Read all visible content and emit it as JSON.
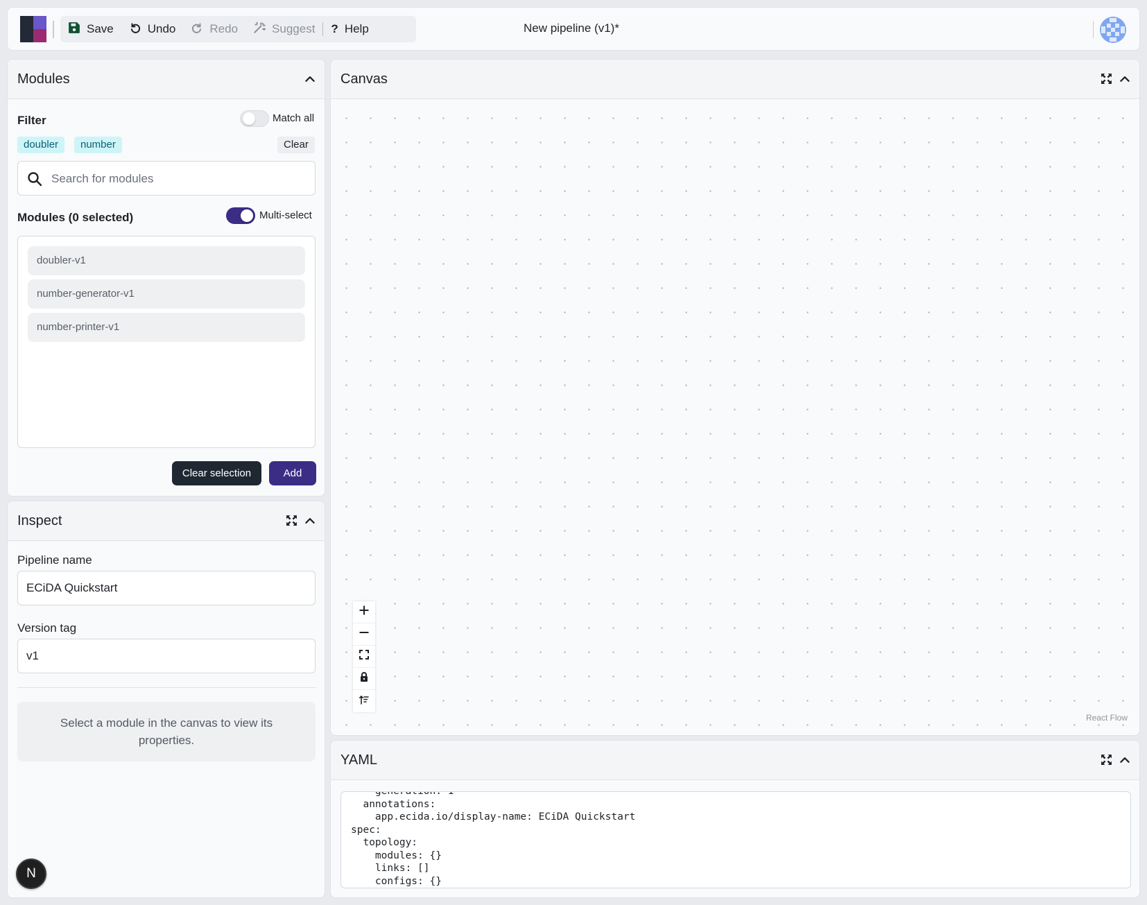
{
  "toolbar": {
    "save": "Save",
    "undo": "Undo",
    "redo": "Redo",
    "suggest": "Suggest",
    "help": "Help"
  },
  "pipeline_title": "New pipeline (v1)*",
  "modules_panel": {
    "title": "Modules",
    "filter_label": "Filter",
    "match_all_label": "Match all",
    "match_all_on": false,
    "chips": [
      "doubler",
      "number"
    ],
    "clear_label": "Clear",
    "search_placeholder": "Search for modules",
    "list_title": "Modules (0 selected)",
    "multi_select_label": "Multi-select",
    "multi_select_on": true,
    "items": [
      "doubler-v1",
      "number-generator-v1",
      "number-printer-v1"
    ],
    "clear_selection_label": "Clear selection",
    "add_label": "Add"
  },
  "inspect_panel": {
    "title": "Inspect",
    "pipeline_name_label": "Pipeline name",
    "pipeline_name_value": "ECiDA Quickstart",
    "version_tag_label": "Version tag",
    "version_tag_value": "v1",
    "empty_message": "Select a module in the canvas to view its properties."
  },
  "badge_letter": "N",
  "canvas_panel": {
    "title": "Canvas",
    "attribution": "React Flow",
    "controls": [
      "zoom-in",
      "zoom-out",
      "fit-view",
      "lock",
      "sort"
    ]
  },
  "yaml_panel": {
    "title": "YAML",
    "code": "    generation: 1\n  annotations:\n    app.ecida.io/display-name: ECiDA Quickstart\nspec:\n  topology:\n    modules: {}\n    links: []\n    configs: {}"
  },
  "colors": {
    "accent": "#3b2d85",
    "dark_button": "#1f2732",
    "chip_bg": "#cdf5f8",
    "chip_text": "#0d5f73",
    "logo_purple": "#6a57c8",
    "logo_magenta": "#9c2a73",
    "logo_dark": "#222a37"
  }
}
